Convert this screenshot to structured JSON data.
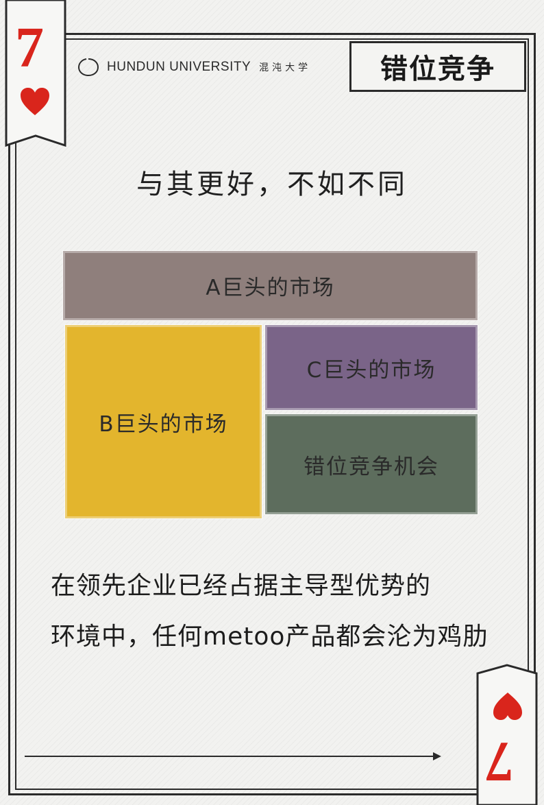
{
  "card": {
    "rank": "7",
    "suit_icon": "heart-icon",
    "suit_color": "#d9251c"
  },
  "header": {
    "logo_icon": "hundun-logo-icon",
    "brand_en": "HUNDUN UNIVERSITY",
    "brand_cn": "混沌大学",
    "title": "错位竞争"
  },
  "headline": "与其更好，不如不同",
  "diagram": {
    "blocks": [
      {
        "label": "A巨头的市场",
        "color": "#8f7f7c"
      },
      {
        "label": "B巨头的市场",
        "color": "#e3b52d"
      },
      {
        "label": "C巨头的市场",
        "color": "#7a6488"
      },
      {
        "label": "错位竞争机会",
        "color": "#5d6d5d"
      }
    ]
  },
  "body": {
    "line1": "在领先企业已经占据主导型优势的",
    "line2": "环境中，任何metoo产品都会沦为鸡肋"
  }
}
